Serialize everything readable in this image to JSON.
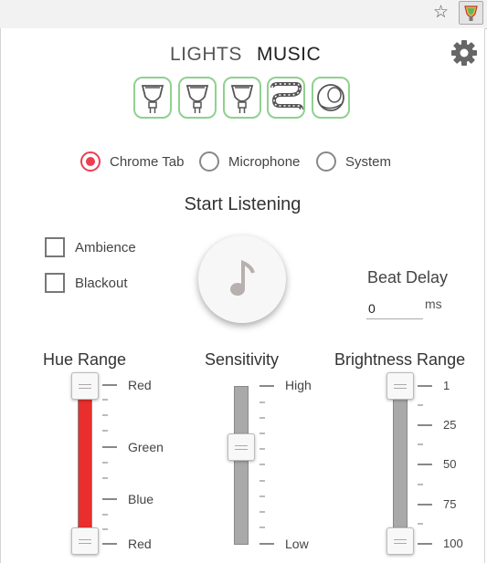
{
  "browser": {
    "bookmark_icon": "star-icon",
    "extension_icon": "extension-icon"
  },
  "tabs": {
    "lights": "LIGHTS",
    "music": "MUSIC"
  },
  "settings_icon": "gear-icon",
  "lights": [
    {
      "icon": "spot-bulb-icon",
      "selected": true
    },
    {
      "icon": "spot-bulb-icon",
      "selected": true
    },
    {
      "icon": "spot-bulb-icon",
      "selected": true
    },
    {
      "icon": "lightstrip-icon",
      "selected": true
    },
    {
      "icon": "lamp-icon",
      "selected": true
    }
  ],
  "source": {
    "options": [
      "Chrome Tab",
      "Microphone",
      "System"
    ],
    "selected": "Chrome Tab",
    "accent": "#ee3e51"
  },
  "start_label": "Start Listening",
  "music_icon": "music-note-icon",
  "checkboxes": {
    "ambience": "Ambience",
    "blackout": "Blackout"
  },
  "beat_delay": {
    "label": "Beat Delay",
    "value": "0",
    "unit": "ms"
  },
  "hue_range": {
    "title": "Hue Range",
    "labels": [
      "Red",
      "Green",
      "Blue",
      "Red"
    ],
    "fill_color": "#e92e2e"
  },
  "sensitivity": {
    "title": "Sensitivity",
    "labels": [
      "High",
      "Low"
    ],
    "value_fraction": 0.4
  },
  "brightness_range": {
    "title": "Brightness Range",
    "labels": [
      "1",
      "25",
      "50",
      "75",
      "100"
    ]
  }
}
